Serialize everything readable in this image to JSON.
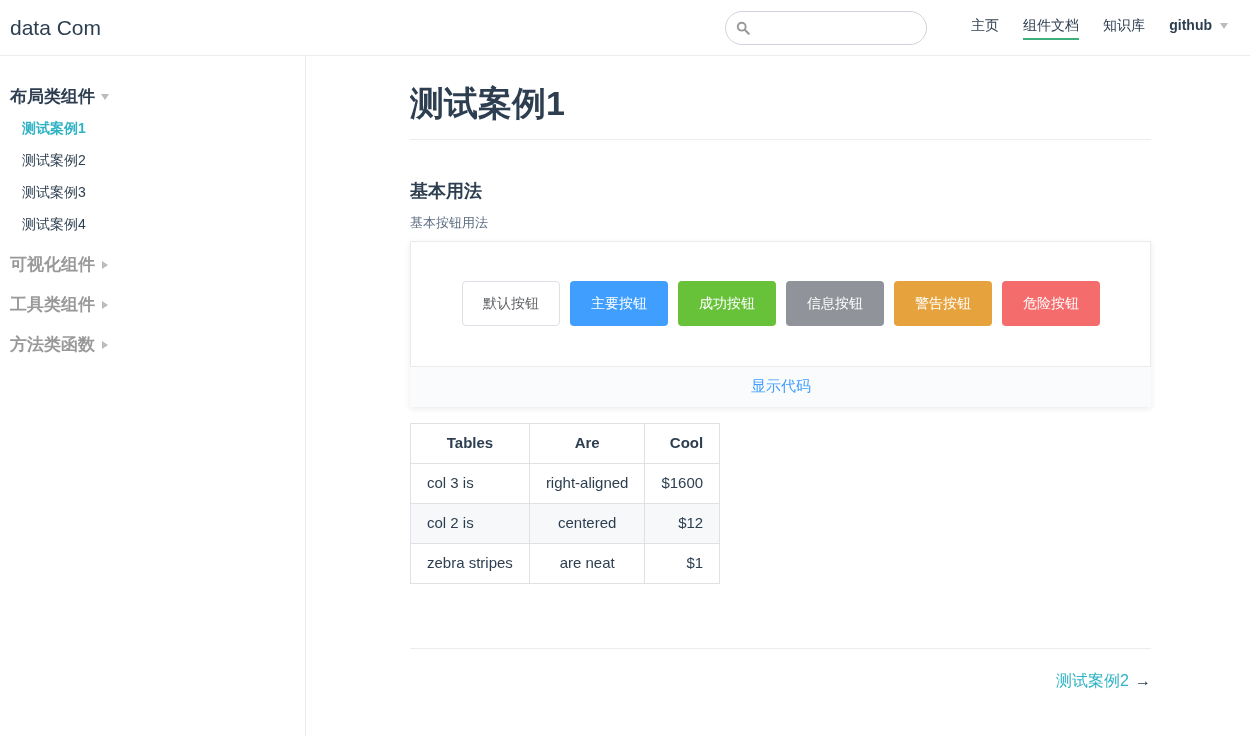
{
  "header": {
    "logo": "data Com",
    "nav": [
      {
        "label": "主页",
        "selected": false
      },
      {
        "label": "组件文档",
        "selected": true
      },
      {
        "label": "知识库",
        "selected": false
      },
      {
        "label": "github",
        "selected": false,
        "dropdown": true
      }
    ]
  },
  "sidebar": {
    "groups": [
      {
        "label": "布局类组件",
        "expanded": true,
        "children": [
          {
            "label": "测试案例1",
            "selected": true
          },
          {
            "label": "测试案例2",
            "selected": false
          },
          {
            "label": "测试案例3",
            "selected": false
          },
          {
            "label": "测试案例4",
            "selected": false
          }
        ]
      },
      {
        "label": "可视化组件",
        "expanded": false
      },
      {
        "label": "工具类组件",
        "expanded": false
      },
      {
        "label": "方法类函数",
        "expanded": false
      }
    ]
  },
  "page": {
    "title": "测试案例1",
    "section_title": "基本用法",
    "section_desc": "基本按钮用法",
    "buttons": [
      {
        "label": "默认按钮",
        "kind": "default"
      },
      {
        "label": "主要按钮",
        "kind": "primary"
      },
      {
        "label": "成功按钮",
        "kind": "success"
      },
      {
        "label": "信息按钮",
        "kind": "info"
      },
      {
        "label": "警告按钮",
        "kind": "warning"
      },
      {
        "label": "危险按钮",
        "kind": "danger"
      }
    ],
    "show_code": "显示代码",
    "table": {
      "columns": [
        "Tables",
        "Are",
        "Cool"
      ],
      "rows": [
        [
          "col 3 is",
          "right-aligned",
          "$1600"
        ],
        [
          "col 2 is",
          "centered",
          "$12"
        ],
        [
          "zebra stripes",
          "are neat",
          "$1"
        ]
      ]
    },
    "next_link": "测试案例2",
    "next_arrow": "→"
  }
}
